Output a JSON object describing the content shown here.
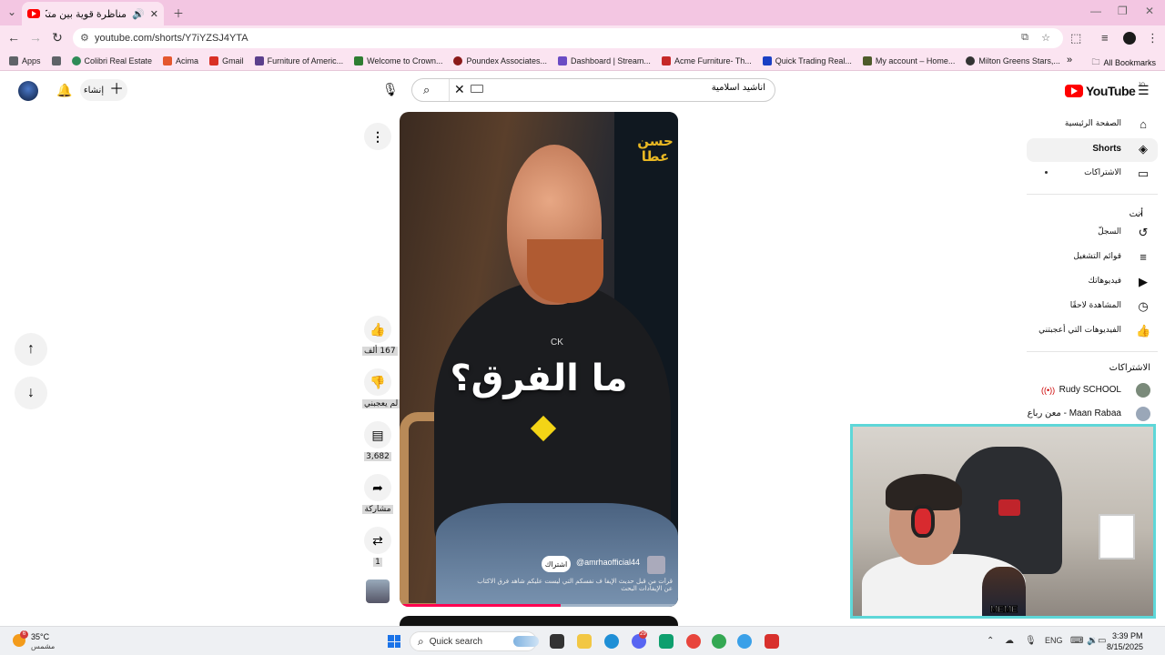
{
  "browser": {
    "tab_title": "مناظرة قوية بين متكري السنة",
    "tab_audio_icon": "speaker-icon",
    "new_tab_icon": "plus-icon",
    "url": "youtube.com/shorts/Y7iYZSJ4YTA"
  },
  "bookmarks": {
    "items": [
      {
        "label": "Apps",
        "color": "#5f6368"
      },
      {
        "label": "",
        "color": "#5f6368"
      },
      {
        "label": "Colibri Real Estate",
        "color": "#2e8b57"
      },
      {
        "label": "Acima",
        "color": "#e4572e"
      },
      {
        "label": "Gmail",
        "color": "#d93025"
      },
      {
        "label": "Furniture of Americ...",
        "color": "#5b3f8c"
      },
      {
        "label": "Welcome to Crown...",
        "color": "#2e7d32"
      },
      {
        "label": "Poundex Associates...",
        "color": "#8b1a1a"
      },
      {
        "label": "Dashboard | Stream...",
        "color": "#6a4bc4"
      },
      {
        "label": "Acme Furniture- Th...",
        "color": "#c62828"
      },
      {
        "label": "Quick Trading Real...",
        "color": "#1a3fc4"
      },
      {
        "label": "My account – Home...",
        "color": "#4e5b2a"
      },
      {
        "label": "Milton Greens Stars,...",
        "color": "#333333"
      }
    ],
    "overflow": "»",
    "all": "All Bookmarks"
  },
  "yt": {
    "create_label": "إنشاء",
    "search_value": "اناشيد اسلامية",
    "logo_text": "YouTube",
    "logo_region": "JO",
    "sidebar": {
      "main": [
        {
          "label": "الصفحة الرئيسية",
          "icon": "home-icon",
          "glyph": "⌂",
          "active": false
        },
        {
          "label": "Shorts",
          "icon": "shorts-icon",
          "glyph": "◈",
          "active": true
        },
        {
          "label": "الاشتراكات",
          "icon": "subscriptions-icon",
          "glyph": "▭",
          "active": false
        }
      ],
      "you_heading": "أنت",
      "you": [
        {
          "label": "السجلّ",
          "icon": "history-icon",
          "glyph": "↺"
        },
        {
          "label": "قوائم التشغيل",
          "icon": "playlists-icon",
          "glyph": "≡"
        },
        {
          "label": "فيديوهاتك",
          "icon": "your-videos-icon",
          "glyph": "▶"
        },
        {
          "label": "المشاهدة لاحقًا",
          "icon": "watch-later-icon",
          "glyph": "◷"
        },
        {
          "label": "الفيديوهات التي أعجبتني",
          "icon": "liked-videos-icon",
          "glyph": "👍"
        }
      ],
      "subs_heading": "الاشتراكات",
      "subscriptions": [
        {
          "name": "Rudy SCHOOL",
          "live": true
        },
        {
          "name": "معن رباع - Maan Rabaa",
          "live": false
        }
      ]
    },
    "short": {
      "caption": "ما الفرق؟",
      "brand_tag": "CK",
      "calligraphy": "حسن عطا",
      "channel": "@amrhaofficial44",
      "subscribe": "اشتراك",
      "description": "قرأت من قبل حديث الإيفا ف نفسكم التي ليست عليكم شاهد فرق الاكتاب",
      "description2": "عن الإيفادات البحث",
      "progress": 0.58
    },
    "actions": {
      "likes": "167 ألف",
      "dislike": "لم يعجبني",
      "comments": "3,682",
      "share": "مشاركة",
      "remix": "1"
    }
  },
  "webcam": {
    "sticker_text": "MEME"
  },
  "taskbar": {
    "weather_temp": "35°C",
    "weather_cond": "مشمس",
    "weather_badge": "6",
    "search_label": "Quick search",
    "lang": "ENG",
    "time": "3:39 PM",
    "date": "8/15/2025",
    "discord_badge": "29"
  }
}
